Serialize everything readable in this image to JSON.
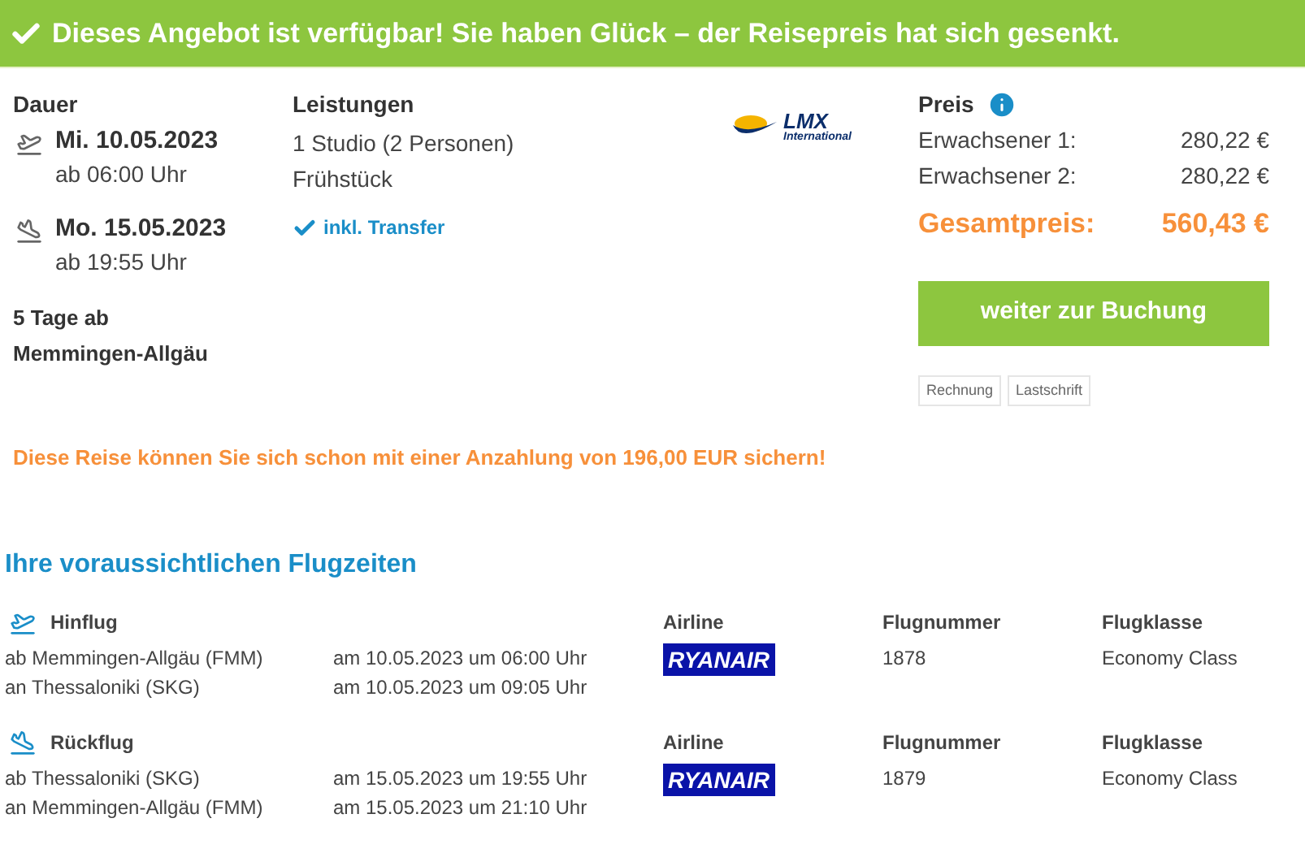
{
  "banner": {
    "text": "Dieses Angebot ist verfügbar! Sie haben Glück – der Reisepreis hat sich gesenkt."
  },
  "duration": {
    "label": "Dauer",
    "legs": [
      {
        "kind": "outbound",
        "date": "Mi. 10.05.2023",
        "time": "ab 06:00 Uhr"
      },
      {
        "kind": "return",
        "date": "Mo. 15.05.2023",
        "time": "ab 19:55 Uhr"
      }
    ],
    "summary": [
      "5 Tage ab",
      "Memmingen-Allgäu"
    ]
  },
  "services": {
    "label": "Leistungen",
    "items": [
      "1 Studio (2 Personen)",
      "Frühstück"
    ],
    "transfer": "inkl. Transfer"
  },
  "operator_logo": {
    "name": "LMX",
    "subtitle": "International"
  },
  "price": {
    "label": "Preis",
    "rows": [
      {
        "label": "Erwachsener 1:",
        "value": "280,22 €"
      },
      {
        "label": "Erwachsener 2:",
        "value": "280,22 €"
      }
    ],
    "total": {
      "label": "Gesamtpreis:",
      "value": "560,43 €"
    },
    "button": "weiter zur Buchung",
    "payment_methods": [
      "Rechnung",
      "Lastschrift"
    ]
  },
  "deposit_note": "Diese Reise können Sie sich schon mit einer Anzahlung von 196,00 EUR sichern!",
  "flights": {
    "title": "Ihre voraussichtlichen Flugzeiten",
    "legs": [
      {
        "kind": "outbound",
        "label": "Hinflug",
        "segments": [
          {
            "route": "ab Memmingen-Allgäu (FMM)",
            "time": "am 10.05.2023 um 06:00 Uhr"
          },
          {
            "route": "an Thessaloniki (SKG)",
            "time": "am 10.05.2023 um 09:05 Uhr"
          }
        ],
        "airline_label": "Airline",
        "airline_logo": "RYANAIR",
        "flight_number_label": "Flugnummer",
        "flight_number": "1878",
        "class_label": "Flugklasse",
        "class": "Economy Class"
      },
      {
        "kind": "return",
        "label": "Rückflug",
        "segments": [
          {
            "route": "ab Thessaloniki (SKG)",
            "time": "am 15.05.2023 um 19:55 Uhr"
          },
          {
            "route": "an Memmingen-Allgäu (FMM)",
            "time": "am 15.05.2023 um 21:10 Uhr"
          }
        ],
        "airline_label": "Airline",
        "airline_logo": "RYANAIR",
        "flight_number_label": "Flugnummer",
        "flight_number": "1879",
        "class_label": "Flugklasse",
        "class": "Economy Class"
      }
    ]
  }
}
